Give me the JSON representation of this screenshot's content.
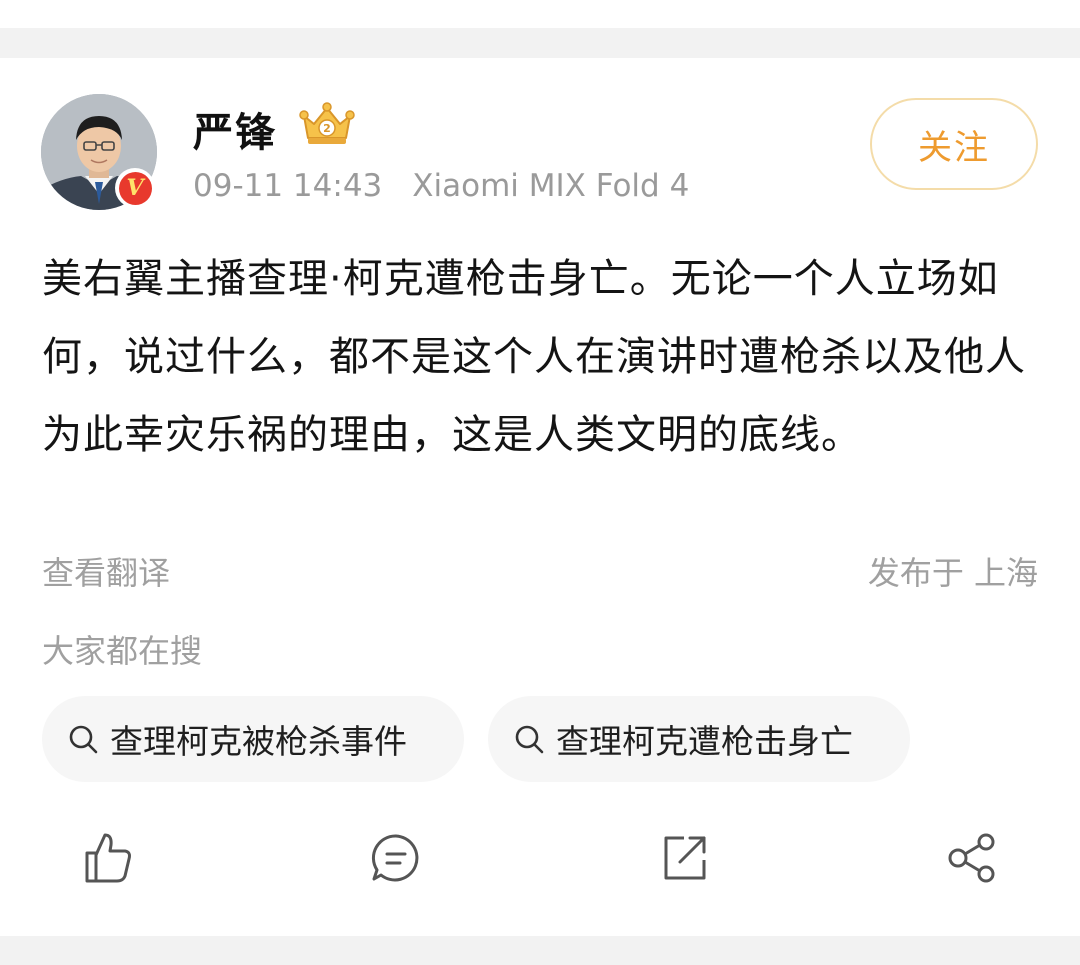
{
  "post": {
    "author": {
      "name": "严锋",
      "verified_icon": "verified-v-icon",
      "level_icon": "crown-level-icon"
    },
    "time": "09-11 14:43",
    "device": "Xiaomi MIX Fold 4",
    "follow_label": "关注",
    "text": "美右翼主播查理·柯克遭枪击身亡。无论一个人立场如何，说过什么，都不是这个人在演讲时遭枪杀以及他人为此幸灾乐祸的理由，这是人类文明的底线。",
    "translate_label": "查看翻译",
    "location": "发布于 上海"
  },
  "trending": {
    "heading": "大家都在搜",
    "chips": [
      {
        "label": "查理柯克被枪杀事件",
        "icon": "search-icon"
      },
      {
        "label": "查理柯克遭枪击身亡",
        "icon": "search-icon"
      }
    ]
  },
  "actions": [
    {
      "name": "like",
      "icon": "thumbs-up-icon"
    },
    {
      "name": "comment",
      "icon": "comment-icon"
    },
    {
      "name": "repost",
      "icon": "repost-icon"
    },
    {
      "name": "share",
      "icon": "share-icon"
    }
  ],
  "colors": {
    "accent": "#ee9b2f",
    "verified_red": "#e8392d",
    "muted_text": "#9a9a9a",
    "page_bg": "#f2f2f2"
  }
}
